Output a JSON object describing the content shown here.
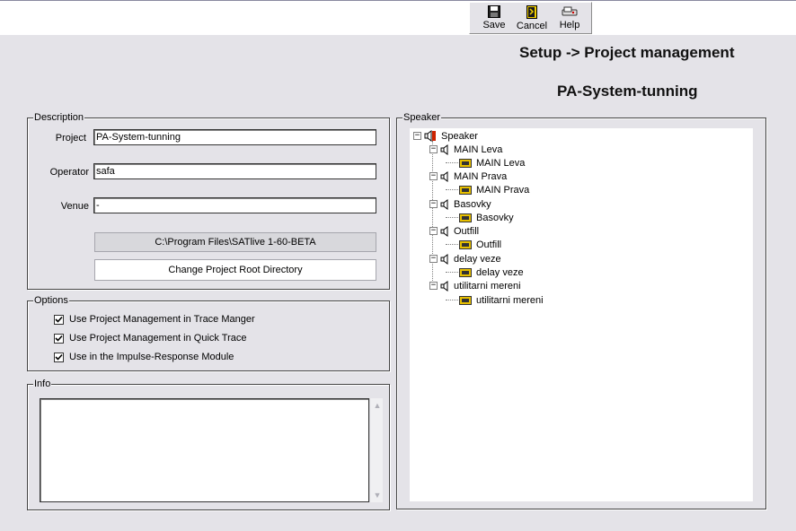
{
  "toolbar": {
    "save_label": "Save",
    "cancel_label": "Cancel",
    "help_label": "Help"
  },
  "header": {
    "breadcrumb": "Setup -> Project management",
    "project_title": "PA-System-tunning"
  },
  "description": {
    "group_label": "Description",
    "project_label": "Project",
    "project_value": "PA-System-tunning",
    "operator_label": "Operator",
    "operator_value": "safa",
    "venue_label": "Venue",
    "venue_value": "-",
    "root_path": "C:\\Program Files\\SATlive 1-60-BETA",
    "change_root_label": "Change Project Root Directory"
  },
  "options": {
    "group_label": "Options",
    "items": [
      {
        "label": "Use Project Management in Trace Manger",
        "checked": true
      },
      {
        "label": "Use Project Management in Quick Trace",
        "checked": true
      },
      {
        "label": "Use in the Impulse-Response Module",
        "checked": true
      }
    ]
  },
  "info": {
    "group_label": "Info",
    "text": ""
  },
  "speaker": {
    "group_label": "Speaker",
    "root_label": "Speaker",
    "groups": [
      {
        "label": "MAIN Leva",
        "child": "MAIN Leva"
      },
      {
        "label": "MAIN Prava",
        "child": "MAIN Prava"
      },
      {
        "label": "Basovky",
        "child": "Basovky"
      },
      {
        "label": "Outfill",
        "child": "Outfill"
      },
      {
        "label": "delay veze",
        "child": "delay veze"
      },
      {
        "label": "utilitarni mereni",
        "child": "utilitarni mereni"
      }
    ]
  },
  "colors": {
    "background": "#e4e3e8",
    "speaker_red": "#cc2200",
    "device_yellow": "#e8c000"
  }
}
